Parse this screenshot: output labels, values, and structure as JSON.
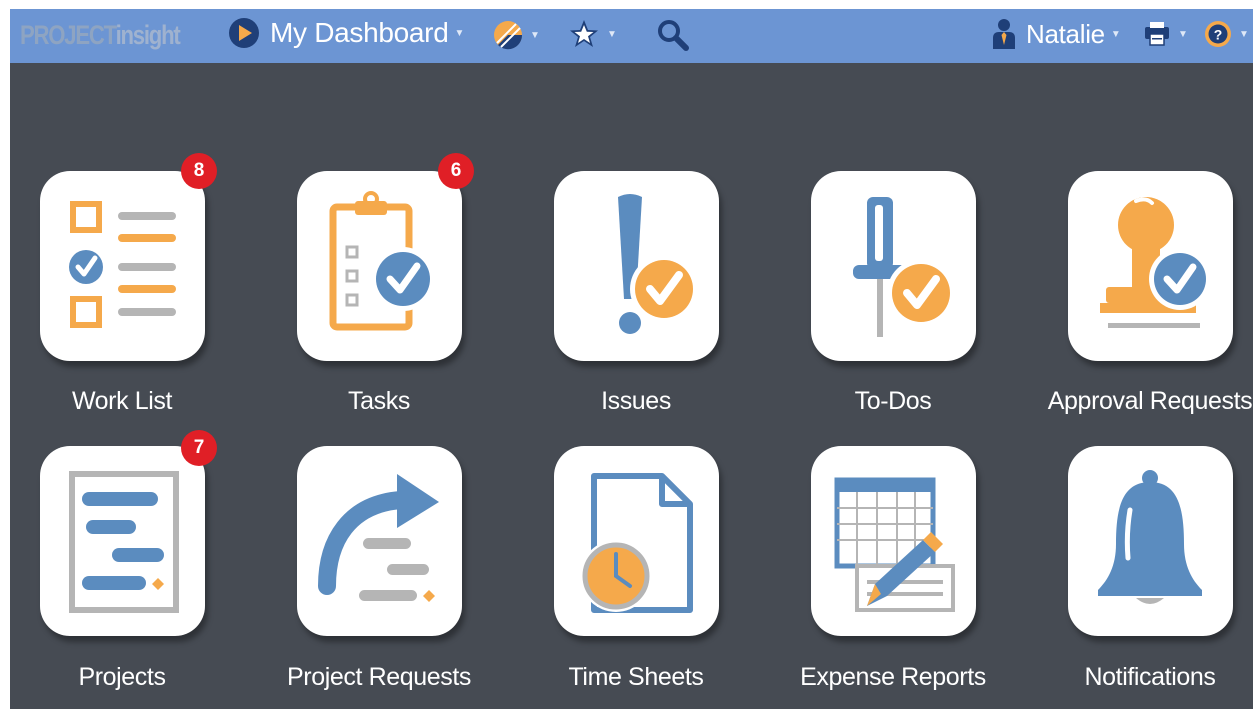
{
  "header": {
    "logo_project": "PROJECT",
    "logo_insight": "insight",
    "dashboard_label": "My Dashboard",
    "user_name": "Natalie"
  },
  "tiles": [
    {
      "label": "Work List",
      "badge": "8"
    },
    {
      "label": "Tasks",
      "badge": "6"
    },
    {
      "label": "Issues"
    },
    {
      "label": "To-Dos"
    },
    {
      "label": "Approval Requests"
    },
    {
      "label": "Projects",
      "badge": "7"
    },
    {
      "label": "Project Requests"
    },
    {
      "label": "Time Sheets"
    },
    {
      "label": "Expense Reports"
    },
    {
      "label": "Notifications"
    }
  ],
  "icons": {
    "dashboard": "play-circle-icon",
    "reports": "pie-chart-icon",
    "favorites": "star-icon",
    "search": "search-icon",
    "user": "user-icon",
    "printer": "printer-icon",
    "help": "help-icon"
  },
  "colors": {
    "topbar": "#6c95d3",
    "background": "#464b53",
    "orange": "#f5a94b",
    "blue": "#5b8cbf",
    "gray": "#b5b5b5",
    "badge": "#e01f26"
  }
}
